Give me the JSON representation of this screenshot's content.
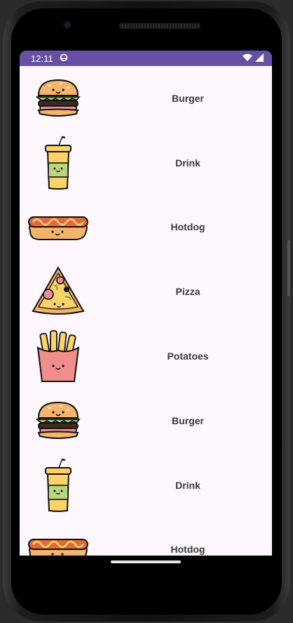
{
  "status_bar": {
    "time": "12:11",
    "background": "#6650a4",
    "icons": [
      "notification-circle-icon",
      "wifi-icon",
      "signal-icon"
    ]
  },
  "list": {
    "items": [
      {
        "label": "Burger",
        "icon": "burger"
      },
      {
        "label": "Drink",
        "icon": "drink"
      },
      {
        "label": "Hotdog",
        "icon": "hotdog"
      },
      {
        "label": "Pizza",
        "icon": "pizza"
      },
      {
        "label": "Potatoes",
        "icon": "potatoes"
      },
      {
        "label": "Burger",
        "icon": "burger"
      },
      {
        "label": "Drink",
        "icon": "drink"
      },
      {
        "label": "Hotdog",
        "icon": "hotdog"
      }
    ]
  },
  "colors": {
    "screen_background": "#fef7fe",
    "accent": "#6650a4"
  }
}
